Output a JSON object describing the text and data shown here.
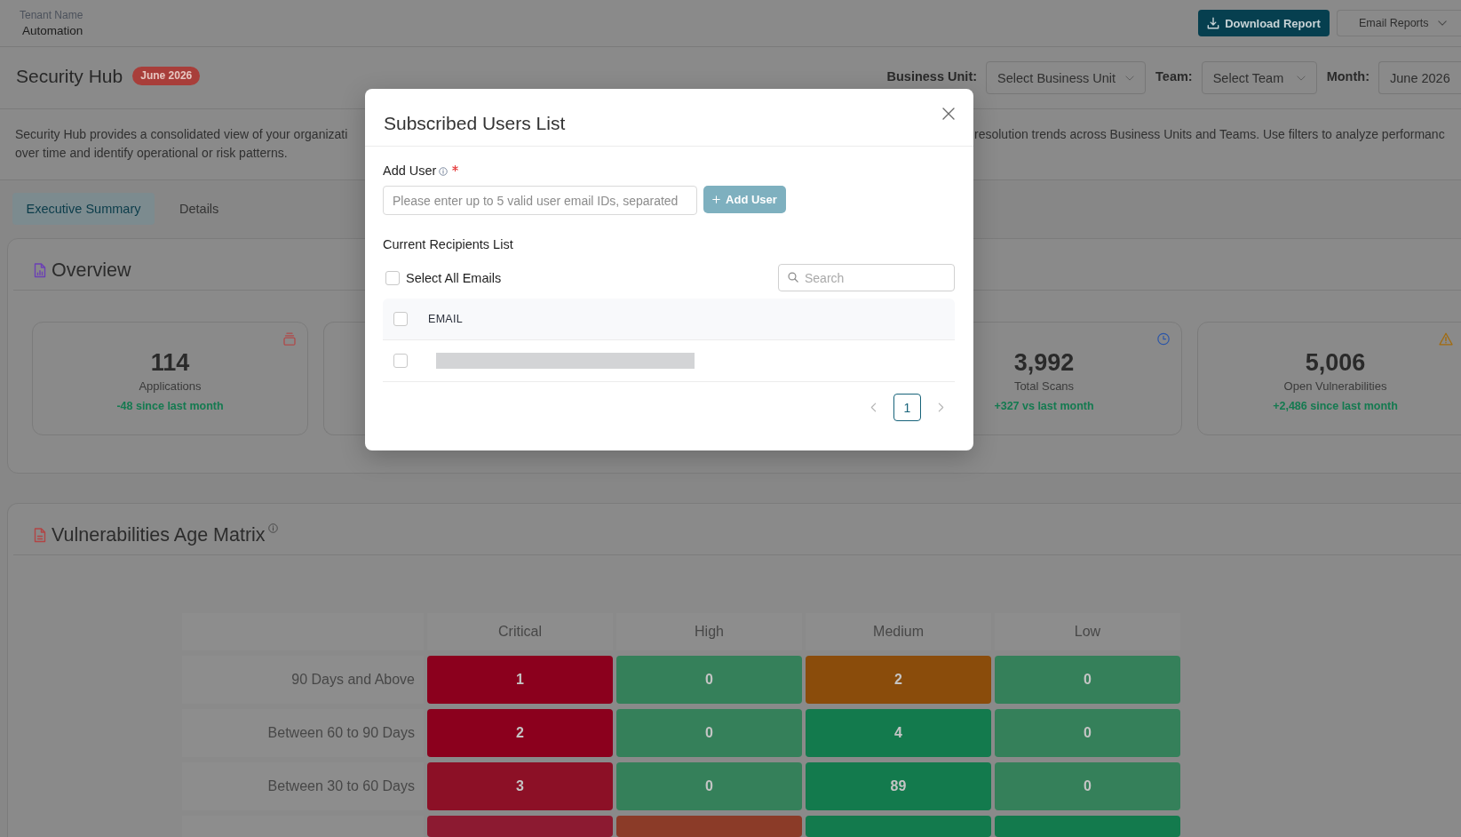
{
  "top_bar": {
    "tenant_label": "Tenant Name",
    "tenant_value": "Automation",
    "buttons": [
      {
        "label": "Download Report",
        "kind": "primary"
      },
      {
        "label": "Email Reports",
        "kind": "dropdown"
      }
    ]
  },
  "header": {
    "title": "Security Hub",
    "badge": "June 2026",
    "filters": [
      {
        "label": "Business Unit:",
        "placeholder": "Select Business Unit"
      },
      {
        "label": "Team:",
        "placeholder": "Select Team"
      },
      {
        "label": "Month:",
        "value": "June 2026"
      }
    ]
  },
  "description": {
    "fragments": [
      "Security Hub provides a consolidated view of your organizati",
      "resolution trends across Business Units and Teams. Use filters to analyze performanc",
      "over time and identify operational or risk patterns."
    ]
  },
  "tabs": [
    {
      "label": "Executive Summary",
      "selected": true
    },
    {
      "label": "Details",
      "selected": false
    }
  ],
  "overview": {
    "title": "Overview",
    "cards": [
      {
        "kind": "applications",
        "value": "114",
        "label": "Applications",
        "change": "-48 since last month"
      },
      {
        "kind": "scans",
        "value": "3,992",
        "label": "Total Scans",
        "change": "+327 vs last month"
      },
      {
        "kind": "vulnerabilities",
        "value": "5,006",
        "label": "Open Vulnerabilities",
        "change": "+2,486 since last month"
      }
    ]
  },
  "matrix": {
    "title": "Vulnerabilities Age Matrix",
    "columns": [
      "Critical",
      "High",
      "Medium",
      "Low"
    ],
    "rows": [
      {
        "label": "90 Days and Above",
        "cells": [
          {
            "value": "1",
            "color": "#8b001d"
          },
          {
            "value": "0",
            "color": "#35805a"
          },
          {
            "value": "2",
            "color": "#8a4c0b"
          },
          {
            "value": "0",
            "color": "#35805a"
          }
        ]
      },
      {
        "label": "Between 60 to 90 Days",
        "cells": [
          {
            "value": "2",
            "color": "#8b001d"
          },
          {
            "value": "0",
            "color": "#35805a"
          },
          {
            "value": "4",
            "color": "#137a4d"
          },
          {
            "value": "0",
            "color": "#35805a"
          }
        ]
      },
      {
        "label": "Between 30 to 60 Days",
        "cells": [
          {
            "value": "3",
            "color": "#8c1026"
          },
          {
            "value": "0",
            "color": "#35805a"
          },
          {
            "value": "89",
            "color": "#137a4d"
          },
          {
            "value": "0",
            "color": "#35805a"
          }
        ]
      },
      {
        "cells": [
          {
            "color": "#8c1a31"
          },
          {
            "color": "#8b3b28"
          },
          {
            "color": "#137a4d"
          },
          {
            "color": "#137a4d"
          }
        ]
      }
    ]
  },
  "modal": {
    "title": "Subscribed Users List",
    "add_user": {
      "label": "Add User",
      "required": true,
      "placeholder": "Please enter up to 5 valid user email IDs, separated",
      "button": {
        "label": "Add User",
        "disabled": true
      }
    },
    "recipients": {
      "title": "Current Recipients List",
      "select_all": {
        "label": "Select All Emails",
        "checked": false
      },
      "search": {
        "placeholder": "Search"
      },
      "header_checked": false,
      "columns": [
        "EMAIL"
      ],
      "rows": [
        {
          "checked": false,
          "redacted": true
        }
      ]
    },
    "pagination": {
      "pages": [
        {
          "label": "1",
          "selected": true
        }
      ]
    }
  }
}
